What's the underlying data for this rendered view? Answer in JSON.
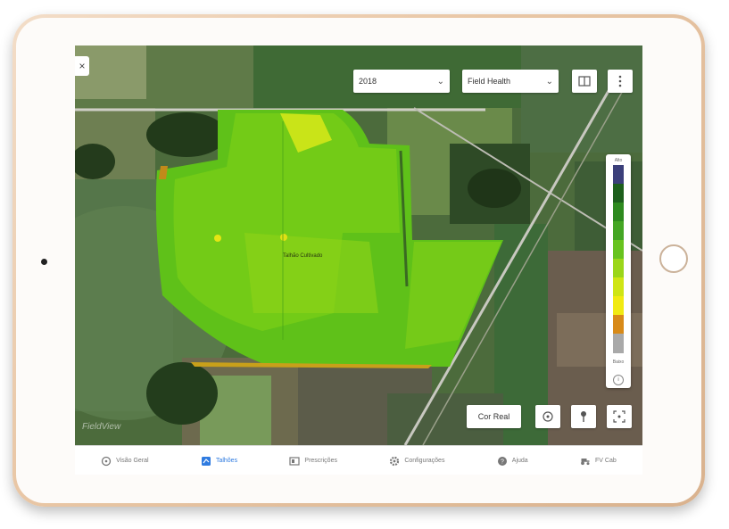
{
  "toolbar": {
    "close_label": "×",
    "year_select": "2018",
    "layer_select": "Field Health"
  },
  "legend": {
    "top_label": "Alto",
    "bottom_label": "Baixo",
    "info_label": "i",
    "colors": [
      "#3b3f7a",
      "#1d5f1c",
      "#2e8a1f",
      "#44a624",
      "#68c31f",
      "#9bd61a",
      "#cfe515",
      "#f1ea12",
      "#d88a18",
      "#a9a9a9"
    ]
  },
  "map": {
    "field_label": "Talhão Cultivado",
    "watermark": "FieldView"
  },
  "controls": {
    "cor_real_label": "Cor Real"
  },
  "tabs": [
    {
      "label": "Visão Geral",
      "icon": "compass-icon"
    },
    {
      "label": "Talhões",
      "icon": "map-icon"
    },
    {
      "label": "Prescrições",
      "icon": "prescription-icon"
    },
    {
      "label": "Configurações",
      "icon": "gear-icon"
    },
    {
      "label": "Ajuda",
      "icon": "help-icon"
    },
    {
      "label": "FV Cab",
      "icon": "tractor-icon"
    }
  ],
  "active_tab": "Talhões"
}
